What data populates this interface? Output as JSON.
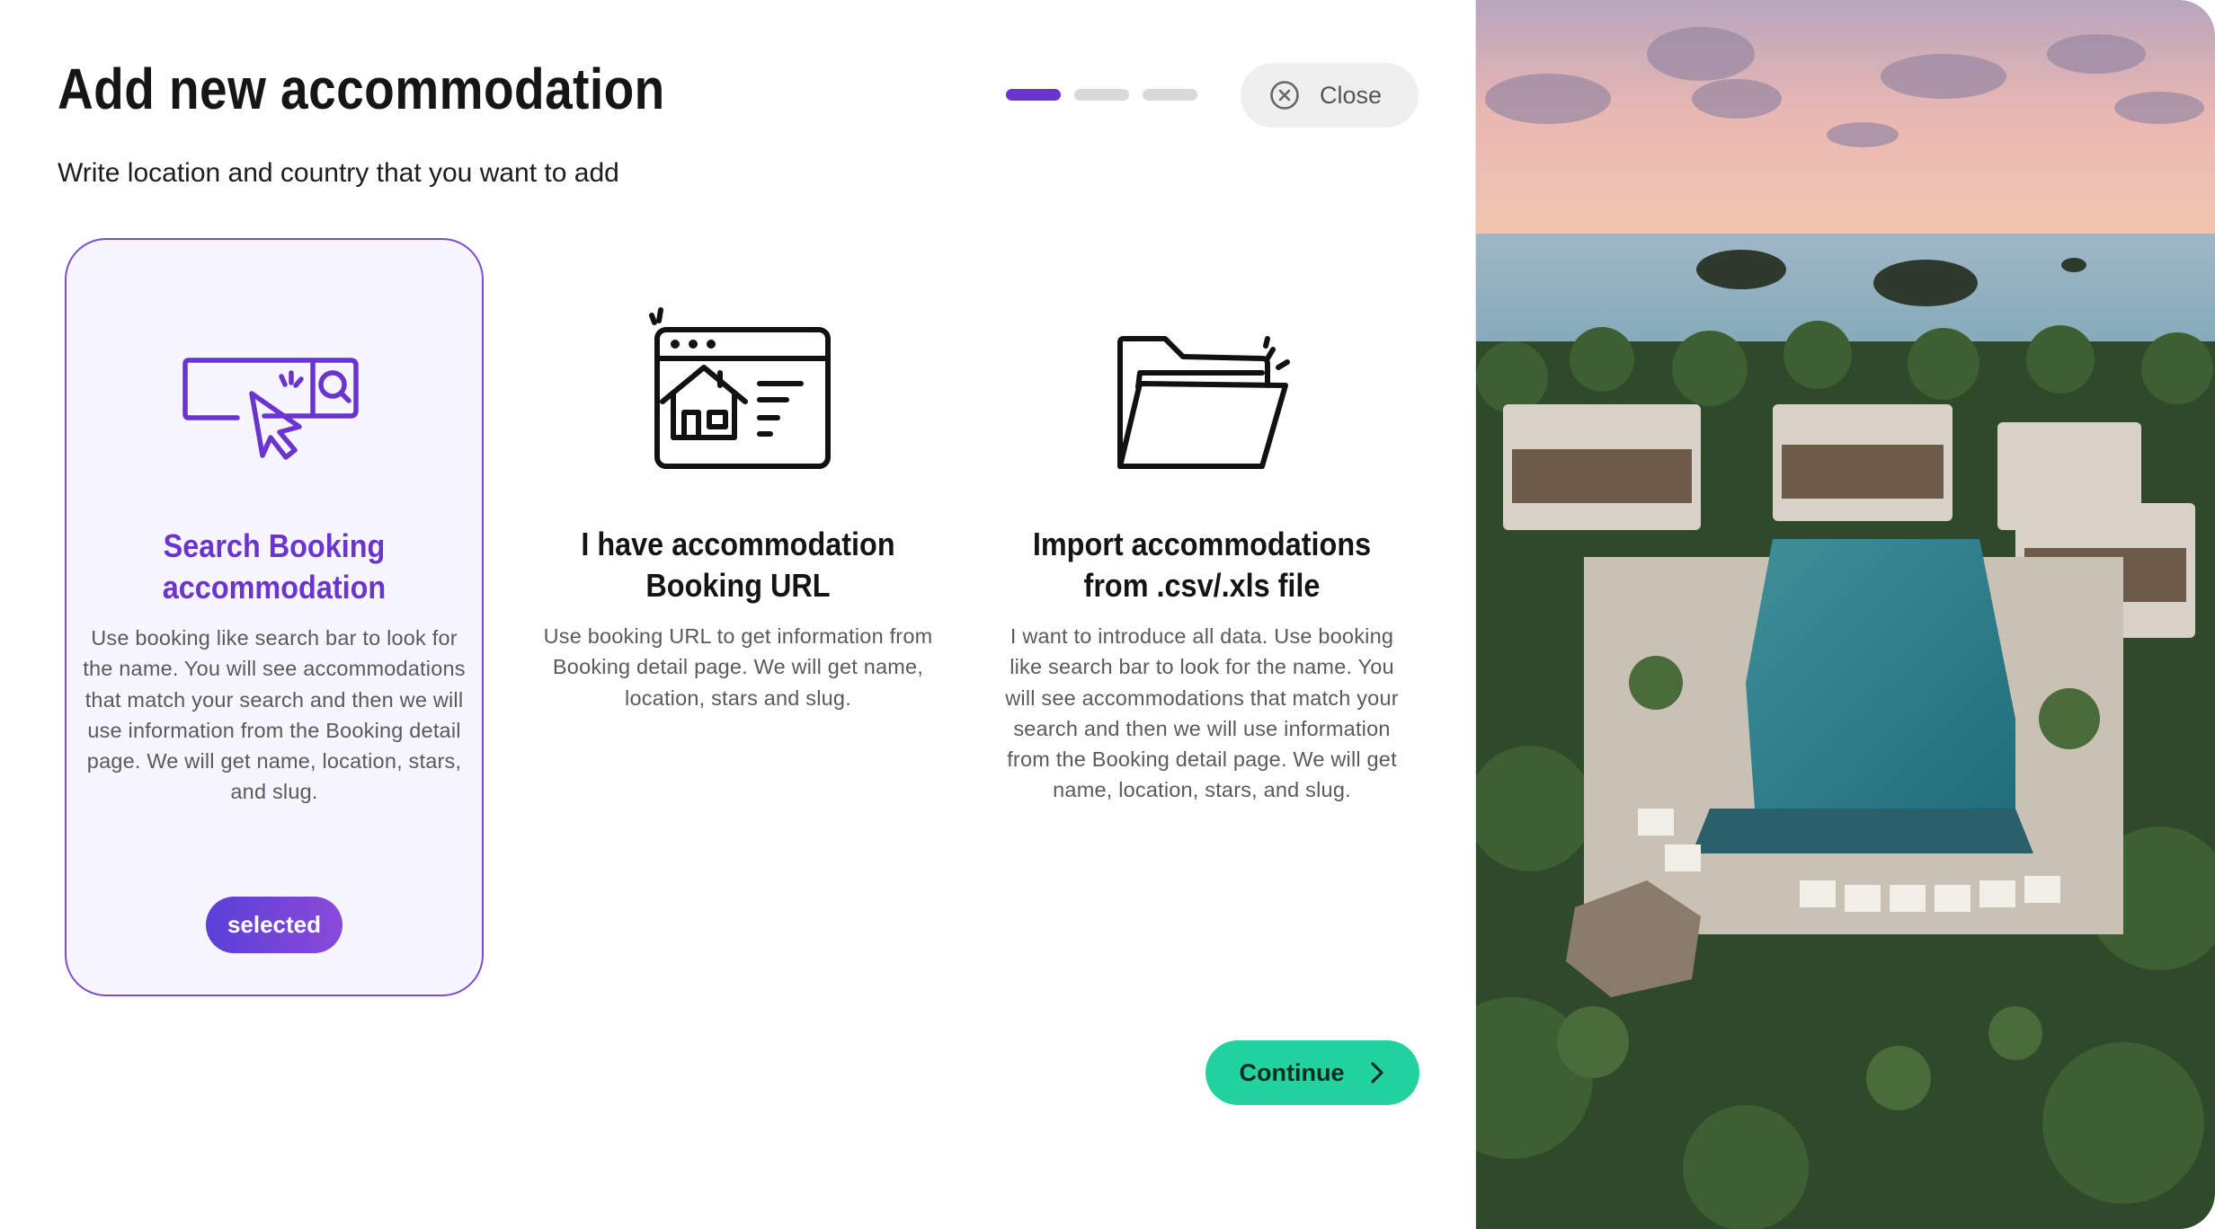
{
  "header": {
    "title": "Add new accommodation",
    "subtitle": "Write location and country that you want to add",
    "close_label": "Close",
    "steps": {
      "total": 3,
      "current": 1
    }
  },
  "options": [
    {
      "title_line1": "Search Booking",
      "title_line2": "accommodation",
      "description": "Use booking like search bar to look for the name. You will see accommodations that match your search and then we will use information from the Booking detail page. We will get name, location, stars, and slug.",
      "badge": "selected",
      "icon": "search-bar-cursor-icon"
    },
    {
      "title_line1": "I have accommodation",
      "title_line2": "Booking URL",
      "description": "Use booking URL to get information from Booking detail page. We will get name, location, stars and slug.",
      "icon": "browser-house-icon"
    },
    {
      "title_line1": "Import accommodations",
      "title_line2": "from .csv/.xls file",
      "description": "I want to introduce all data. Use booking like search bar to look for the name. You will see accommodations that match your search and then we will use information from the Booking detail page. We will get name, location, stars, and slug.",
      "icon": "folder-icon"
    }
  ],
  "footer": {
    "continue_label": "Continue"
  },
  "colors": {
    "accent": "#6a35cf",
    "continue": "#22d3a0",
    "close_bg": "#efefef",
    "card_selected_bg": "#f7f5fd"
  }
}
